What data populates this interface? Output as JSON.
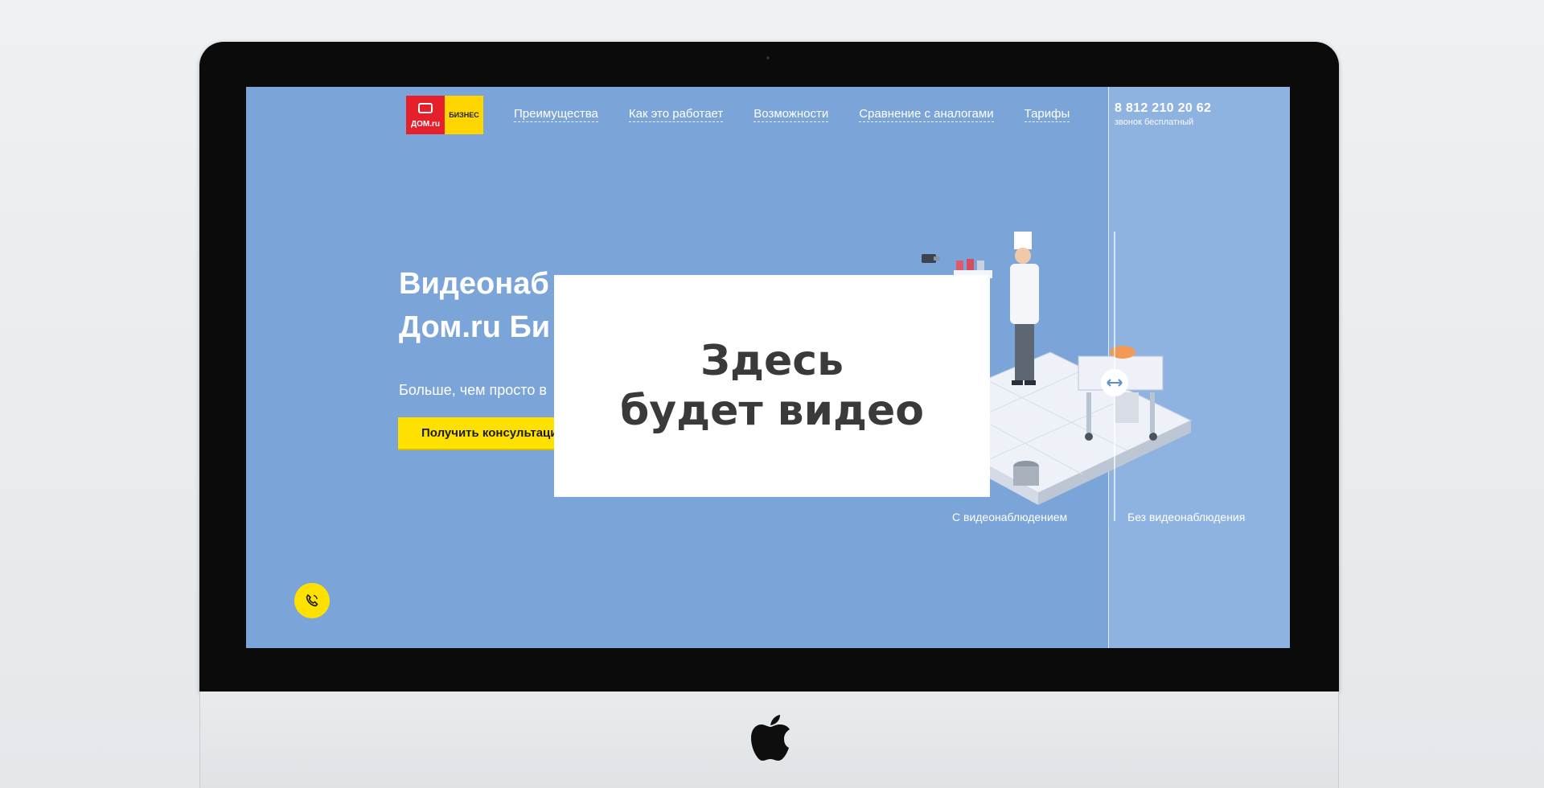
{
  "logo": {
    "brand": "ДОМ.ru",
    "business": "БИЗНЕС"
  },
  "nav": {
    "items": [
      "Преимущества",
      "Как это работает",
      "Возможности",
      "Сравнение с аналогами",
      "Тарифы"
    ]
  },
  "contact": {
    "phone": "8 812 210 20 62",
    "note": "звонок бесплатный"
  },
  "hero": {
    "title_line1": "Видеонаб",
    "title_line2": "Дом.ru Би",
    "subtitle": "Больше, чем просто в",
    "cta_label": "Получить консультаци"
  },
  "comparison": {
    "with_label": "С видеонаблюдением",
    "without_label": "Без видеонаблюдения"
  },
  "video_overlay": {
    "line1": "Здесь",
    "line2": "будет видео"
  },
  "colors": {
    "page_background": "#7ba5d8",
    "panel_background": "#8fb3e0",
    "accent_yellow": "#ffe100",
    "brand_red": "#e5202a"
  },
  "icons": {
    "call": "phone-call-icon",
    "slider": "compare-arrows-icon",
    "device": "apple-logo-icon"
  }
}
